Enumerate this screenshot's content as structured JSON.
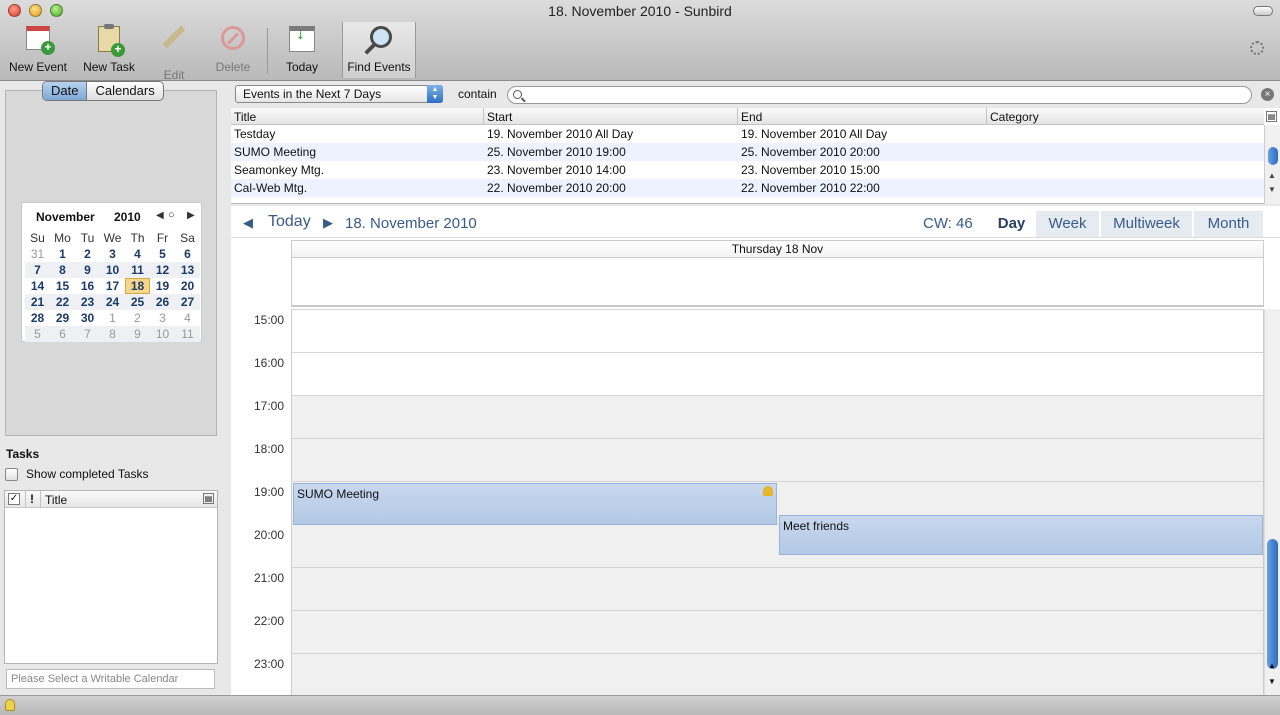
{
  "window": {
    "title": "18. November 2010 - Sunbird"
  },
  "toolbar": {
    "new_event": "New Event",
    "new_task": "New Task",
    "edit": "Edit",
    "delete": "Delete",
    "today": "Today",
    "find_events": "Find Events"
  },
  "sidebar": {
    "tab_date": "Date",
    "tab_calendars": "Calendars",
    "minical": {
      "month": "November",
      "year": "2010",
      "weekdays": [
        "Su",
        "Mo",
        "Tu",
        "We",
        "Th",
        "Fr",
        "Sa"
      ],
      "weeks": [
        [
          "31",
          "1",
          "2",
          "3",
          "4",
          "5",
          "6"
        ],
        [
          "7",
          "8",
          "9",
          "10",
          "11",
          "12",
          "13"
        ],
        [
          "14",
          "15",
          "16",
          "17",
          "18",
          "19",
          "20"
        ],
        [
          "21",
          "22",
          "23",
          "24",
          "25",
          "26",
          "27"
        ],
        [
          "28",
          "29",
          "30",
          "1",
          "2",
          "3",
          "4"
        ],
        [
          "5",
          "6",
          "7",
          "8",
          "9",
          "10",
          "11"
        ]
      ],
      "selected_day": "18"
    },
    "tasks_title": "Tasks",
    "show_completed": "Show completed Tasks",
    "task_col_check": "✓",
    "task_col_priority": "!",
    "task_col_title": "Title",
    "quick_add_placeholder": "Please Select a Writable Calendar"
  },
  "filter": {
    "selected": "Events in the Next 7 Days",
    "contain_label": "contain",
    "search_value": ""
  },
  "event_list": {
    "columns": [
      "Title",
      "Start",
      "End",
      "Category"
    ],
    "rows": [
      {
        "title": "Testday",
        "start": "19. November 2010 All Day",
        "end": "19. November 2010 All Day",
        "category": ""
      },
      {
        "title": "SUMO Meeting",
        "start": "25. November 2010 19:00",
        "end": "25. November 2010 20:00",
        "category": ""
      },
      {
        "title": "Seamonkey Mtg.",
        "start": "23. November 2010 14:00",
        "end": "23. November 2010 15:00",
        "category": ""
      },
      {
        "title": "Cal-Web Mtg.",
        "start": "22. November 2010 20:00",
        "end": "22. November 2010 22:00",
        "category": ""
      }
    ]
  },
  "dayview": {
    "today_label": "Today",
    "date_label": "18. November 2010",
    "cw_label": "CW: 46",
    "views": [
      "Day",
      "Week",
      "Multiweek",
      "Month"
    ],
    "active_view": "Day",
    "day_header": "Thursday 18 Nov",
    "hours": [
      "15:00",
      "16:00",
      "17:00",
      "18:00",
      "19:00",
      "20:00",
      "21:00",
      "22:00",
      "23:00"
    ],
    "events": [
      {
        "title": "SUMO Meeting",
        "has_alarm": true
      },
      {
        "title": "Meet friends",
        "has_alarm": false
      }
    ]
  }
}
